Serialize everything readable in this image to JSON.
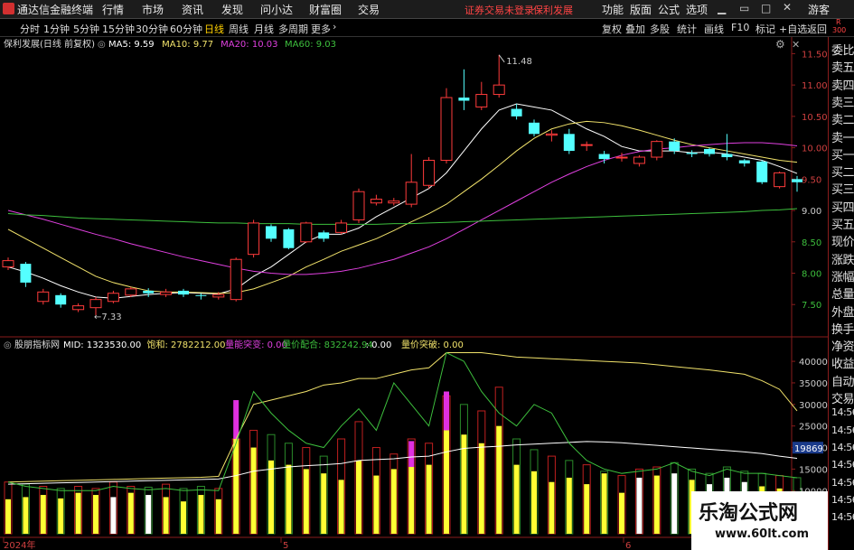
{
  "topbar": {
    "app_title": "通达信金融终端",
    "menus": [
      "行情",
      "市场",
      "资讯",
      "发现",
      "问小达",
      "财富圈",
      "交易"
    ],
    "notice": "证券交易未登录",
    "stock": "保利发展",
    "right_menus": [
      "功能",
      "版面",
      "公式",
      "选项"
    ],
    "user": "游客"
  },
  "toolbar": {
    "periods": [
      "分时",
      "1分钟",
      "5分钟",
      "15分钟",
      "30分钟",
      "60分钟",
      "日线",
      "周线",
      "月线",
      "多周期",
      "更多"
    ],
    "active_period": "日线",
    "right_buttons": [
      "复权",
      "叠加",
      "多股",
      "统计",
      "画线",
      "F10",
      "标记",
      "+自选",
      "返回"
    ],
    "badge_top": "R",
    "badge_bottom": "300"
  },
  "main_panel": {
    "title": "保利发展(日线 前复权)",
    "legend": [
      {
        "text": "MA5: 9.59",
        "color": "#ffffff"
      },
      {
        "text": "MA10: 9.77",
        "color": "#f2e36b"
      },
      {
        "text": "MA20: 10.03",
        "color": "#e040e0"
      },
      {
        "text": "MA60: 9.03",
        "color": "#3dbf3d"
      }
    ],
    "high_label": "11.48",
    "low_label": "7.33",
    "yticks": [
      {
        "v": "11.50",
        "c": "#d04040"
      },
      {
        "v": "11.00",
        "c": "#d04040"
      },
      {
        "v": "10.50",
        "c": "#d04040"
      },
      {
        "v": "10.00",
        "c": "#d04040"
      },
      {
        "v": "9.50",
        "c": "#d04040"
      },
      {
        "v": "9.00",
        "c": "#cccccc"
      },
      {
        "v": "8.50",
        "c": "#3dbf3d"
      },
      {
        "v": "8.00",
        "c": "#3dbf3d"
      },
      {
        "v": "7.50",
        "c": "#3dbf3d"
      }
    ]
  },
  "sub_panel": {
    "title": "股朋指标网",
    "legend": [
      {
        "text": "MID: 1323530.00",
        "color": "#ffffff"
      },
      {
        "text": "饱和: 2782212.00",
        "color": "#f2e36b"
      },
      {
        "text": "量能突变: 0.00",
        "color": "#e040e0"
      },
      {
        "text": "量价配合: 832242.94",
        "color": "#3dbf3d"
      },
      {
        "text": ": 0.00",
        "color": "#ffffff"
      },
      {
        "text": "量价突破: 0.00",
        "color": "#f2e36b"
      }
    ],
    "yticks": [
      "40000",
      "35000",
      "30000",
      "25000",
      "20000",
      "15000",
      "10000"
    ],
    "highlight_value": "19869"
  },
  "x_axis": {
    "labels": [
      "2024年",
      "5",
      "6"
    ]
  },
  "sidebar": {
    "items": [
      "委比",
      "卖五",
      "卖四",
      "卖三",
      "卖二",
      "卖一",
      "买一",
      "买二",
      "买三",
      "买四",
      "买五",
      "现价",
      "涨跌",
      "涨幅",
      "总量",
      "外盘",
      "换手",
      "净资",
      "收益",
      "自动",
      "交易",
      "14:56",
      "14:56",
      "14:56",
      "14:56",
      "14:56",
      "14:56",
      "14:56"
    ]
  },
  "watermark": {
    "line1": "乐淘公式网",
    "line2": "www.60lt.com"
  },
  "chart_data": {
    "type": "candlestick",
    "candles": [
      {
        "o": 8.1,
        "c": 8.2,
        "h": 8.25,
        "l": 8.05
      },
      {
        "o": 8.15,
        "c": 7.85,
        "h": 8.18,
        "l": 7.78
      },
      {
        "o": 7.55,
        "c": 7.7,
        "h": 7.75,
        "l": 7.5
      },
      {
        "o": 7.65,
        "c": 7.5,
        "h": 7.68,
        "l": 7.45
      },
      {
        "o": 7.42,
        "c": 7.48,
        "h": 7.52,
        "l": 7.38
      },
      {
        "o": 7.45,
        "c": 7.58,
        "h": 7.62,
        "l": 7.33
      },
      {
        "o": 7.55,
        "c": 7.68,
        "h": 7.72,
        "l": 7.52
      },
      {
        "o": 7.65,
        "c": 7.75,
        "h": 7.78,
        "l": 7.62
      },
      {
        "o": 7.72,
        "c": 7.68,
        "h": 7.76,
        "l": 7.62
      },
      {
        "o": 7.66,
        "c": 7.7,
        "h": 7.75,
        "l": 7.62
      },
      {
        "o": 7.72,
        "c": 7.66,
        "h": 7.75,
        "l": 7.62
      },
      {
        "o": 7.65,
        "c": 7.64,
        "h": 7.68,
        "l": 7.58
      },
      {
        "o": 7.62,
        "c": 7.66,
        "h": 7.7,
        "l": 7.58
      },
      {
        "o": 7.58,
        "c": 8.22,
        "h": 8.25,
        "l": 7.55
      },
      {
        "o": 8.3,
        "c": 8.8,
        "h": 8.85,
        "l": 8.25
      },
      {
        "o": 8.75,
        "c": 8.55,
        "h": 8.78,
        "l": 8.5
      },
      {
        "o": 8.7,
        "c": 8.4,
        "h": 8.72,
        "l": 8.38
      },
      {
        "o": 8.5,
        "c": 8.8,
        "h": 8.82,
        "l": 8.48
      },
      {
        "o": 8.65,
        "c": 8.55,
        "h": 8.68,
        "l": 8.5
      },
      {
        "o": 8.65,
        "c": 8.8,
        "h": 8.85,
        "l": 8.62
      },
      {
        "o": 8.85,
        "c": 9.3,
        "h": 9.35,
        "l": 8.8
      },
      {
        "o": 9.12,
        "c": 9.18,
        "h": 9.25,
        "l": 9.08
      },
      {
        "o": 9.12,
        "c": 9.15,
        "h": 9.2,
        "l": 9.08
      },
      {
        "o": 9.1,
        "c": 9.45,
        "h": 9.9,
        "l": 9.05
      },
      {
        "o": 9.4,
        "c": 9.8,
        "h": 9.85,
        "l": 9.35
      },
      {
        "o": 9.8,
        "c": 10.8,
        "h": 10.95,
        "l": 9.75
      },
      {
        "o": 10.8,
        "c": 10.75,
        "h": 11.25,
        "l": 10.6
      },
      {
        "o": 10.65,
        "c": 10.85,
        "h": 11.05,
        "l": 10.6
      },
      {
        "o": 10.85,
        "c": 11.0,
        "h": 11.48,
        "l": 10.8
      },
      {
        "o": 10.62,
        "c": 10.5,
        "h": 10.7,
        "l": 10.45
      },
      {
        "o": 10.4,
        "c": 10.22,
        "h": 10.45,
        "l": 10.18
      },
      {
        "o": 10.2,
        "c": 10.22,
        "h": 10.28,
        "l": 10.1
      },
      {
        "o": 10.22,
        "c": 9.95,
        "h": 10.3,
        "l": 9.9
      },
      {
        "o": 10.05,
        "c": 10.05,
        "h": 10.1,
        "l": 9.95
      },
      {
        "o": 9.9,
        "c": 9.82,
        "h": 9.95,
        "l": 9.75
      },
      {
        "o": 9.85,
        "c": 9.85,
        "h": 9.92,
        "l": 9.78
      },
      {
        "o": 9.75,
        "c": 9.85,
        "h": 9.88,
        "l": 9.7
      },
      {
        "o": 9.85,
        "c": 10.1,
        "h": 10.12,
        "l": 9.8
      },
      {
        "o": 10.1,
        "c": 9.95,
        "h": 10.15,
        "l": 9.9
      },
      {
        "o": 9.92,
        "c": 9.9,
        "h": 9.96,
        "l": 9.85
      },
      {
        "o": 9.98,
        "c": 9.9,
        "h": 10.0,
        "l": 9.86
      },
      {
        "o": 9.9,
        "c": 9.85,
        "h": 10.22,
        "l": 9.8
      },
      {
        "o": 9.8,
        "c": 9.75,
        "h": 9.82,
        "l": 9.7
      },
      {
        "o": 9.78,
        "c": 9.45,
        "h": 9.8,
        "l": 9.42
      },
      {
        "o": 9.38,
        "c": 9.6,
        "h": 9.62,
        "l": 9.35
      },
      {
        "o": 9.5,
        "c": 9.45,
        "h": 9.55,
        "l": 9.3
      }
    ],
    "ma": {
      "MA5": [
        8.1,
        8.02,
        7.92,
        7.8,
        7.7,
        7.62,
        7.6,
        7.63,
        7.66,
        7.68,
        7.69,
        7.68,
        7.67,
        7.75,
        7.95,
        8.1,
        8.3,
        8.5,
        8.62,
        8.62,
        8.72,
        8.9,
        9.05,
        9.2,
        9.35,
        9.6,
        9.95,
        10.3,
        10.6,
        10.7,
        10.65,
        10.6,
        10.45,
        10.3,
        10.18,
        10.02,
        9.95,
        9.95,
        9.95,
        9.92,
        9.93,
        9.9,
        9.85,
        9.8,
        9.7,
        9.59
      ],
      "MA10": [
        8.7,
        8.55,
        8.4,
        8.25,
        8.1,
        7.95,
        7.85,
        7.78,
        7.72,
        7.7,
        7.7,
        7.69,
        7.68,
        7.69,
        7.75,
        7.85,
        7.95,
        8.1,
        8.22,
        8.35,
        8.45,
        8.55,
        8.68,
        8.82,
        8.95,
        9.1,
        9.3,
        9.5,
        9.72,
        9.95,
        10.15,
        10.3,
        10.38,
        10.42,
        10.4,
        10.35,
        10.28,
        10.2,
        10.12,
        10.05,
        10.0,
        9.95,
        9.9,
        9.85,
        9.8,
        9.77
      ],
      "MA20": [
        9.0,
        8.93,
        8.86,
        8.78,
        8.7,
        8.62,
        8.55,
        8.47,
        8.4,
        8.33,
        8.26,
        8.2,
        8.14,
        8.08,
        8.03,
        8.0,
        7.98,
        7.98,
        8.0,
        8.03,
        8.08,
        8.15,
        8.22,
        8.32,
        8.42,
        8.55,
        8.7,
        8.85,
        9.0,
        9.15,
        9.3,
        9.45,
        9.58,
        9.7,
        9.8,
        9.88,
        9.94,
        9.98,
        10.0,
        10.03,
        10.05,
        10.07,
        10.08,
        10.08,
        10.06,
        10.03
      ],
      "MA60": [
        8.95,
        8.93,
        8.92,
        8.9,
        8.88,
        8.87,
        8.86,
        8.85,
        8.84,
        8.83,
        8.82,
        8.81,
        8.8,
        8.8,
        8.79,
        8.79,
        8.79,
        8.78,
        8.78,
        8.78,
        8.78,
        8.78,
        8.79,
        8.79,
        8.8,
        8.81,
        8.82,
        8.83,
        8.84,
        8.85,
        8.86,
        8.87,
        8.88,
        8.89,
        8.9,
        8.91,
        8.92,
        8.93,
        8.94,
        8.95,
        8.96,
        8.97,
        8.98,
        9.0,
        9.01,
        9.03
      ]
    },
    "volume": [
      12000,
      11500,
      11000,
      10500,
      11000,
      10500,
      12000,
      11000,
      10800,
      11500,
      10500,
      11000,
      10500,
      22000,
      24000,
      23000,
      21000,
      20000,
      18000,
      22000,
      26000,
      20000,
      18500,
      22000,
      21000,
      32000,
      30000,
      28500,
      34000,
      22000,
      19500,
      18000,
      17000,
      16000,
      14500,
      13500,
      15000,
      15500,
      16500,
      15000,
      14000,
      15500,
      14500,
      14000,
      13500,
      13000
    ],
    "indicator": {
      "yellow_bars": [
        8000,
        8500,
        9000,
        8200,
        9500,
        9000,
        8500,
        9500,
        9000,
        8500,
        7500,
        9000,
        8000,
        22000,
        20000,
        17000,
        16000,
        15000,
        14000,
        12500,
        17000,
        13500,
        15000,
        15500,
        16000,
        24000,
        23000,
        21000,
        25000,
        16000,
        14500,
        12000,
        13000,
        11500,
        14000,
        9500,
        13000,
        13500,
        14000,
        12500,
        11500,
        13000,
        12000,
        11000,
        10500,
        9500
      ],
      "white_bar_indices": [
        6,
        8,
        36,
        38,
        40,
        41,
        42
      ],
      "magenta_spikes": [
        {
          "i": 13,
          "v": 9000
        },
        {
          "i": 23,
          "v": 6000
        },
        {
          "i": 25,
          "v": 9000
        }
      ],
      "white_line": [
        11500,
        11600,
        11700,
        11800,
        11900,
        12000,
        12100,
        12200,
        12300,
        12400,
        12500,
        12600,
        12700,
        13500,
        14500,
        15000,
        15500,
        15800,
        16000,
        16300,
        17000,
        17200,
        17400,
        17800,
        18000,
        19000,
        19800,
        20100,
        20300,
        20600,
        20800,
        21000,
        21200,
        21400,
        21300,
        21100,
        20800,
        20500,
        20200,
        19900,
        19600,
        19300,
        19000,
        18600,
        18000,
        17500
      ],
      "yellow_line": [
        12000,
        12100,
        12200,
        12300,
        12400,
        12500,
        12600,
        12700,
        12800,
        12900,
        13000,
        13100,
        13300,
        22000,
        30000,
        31000,
        32000,
        33000,
        34500,
        35000,
        36000,
        36000,
        37000,
        38000,
        38500,
        42000,
        42000,
        42000,
        41500,
        41000,
        40800,
        40600,
        40400,
        40200,
        40000,
        39800,
        39600,
        39200,
        38800,
        38400,
        38000,
        37500,
        37000,
        35500,
        33500,
        28500
      ],
      "green_line": [
        12000,
        11000,
        10500,
        10000,
        10000,
        10000,
        11000,
        10500,
        10200,
        10500,
        10000,
        10200,
        10000,
        21000,
        33000,
        28000,
        24000,
        21000,
        20000,
        25000,
        29000,
        24000,
        35000,
        30000,
        25000,
        42000,
        40000,
        33000,
        28000,
        25000,
        30000,
        28000,
        21000,
        17000,
        15000,
        14000,
        14500,
        15000,
        16500,
        14500,
        13500,
        15000,
        14000,
        14000,
        13500,
        13000
      ]
    }
  }
}
